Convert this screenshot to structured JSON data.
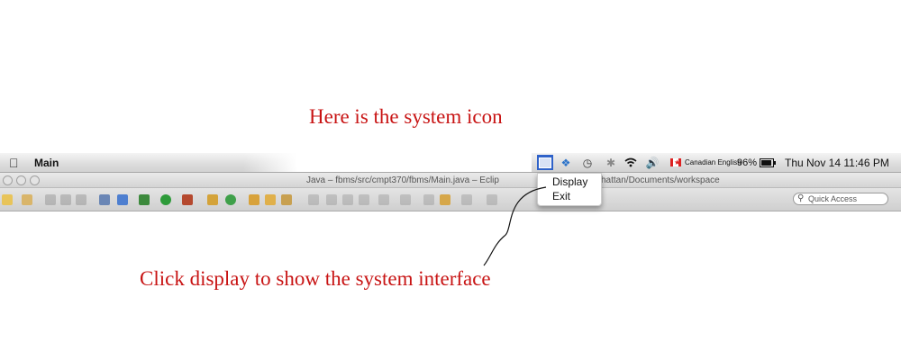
{
  "annotations": {
    "top": "Here is the system icon",
    "bottom": "Click display to show the system interface"
  },
  "menubar": {
    "app_name": "Main",
    "language": "Canadian English",
    "battery": "96%",
    "clock": "Thu Nov 14  11:46 PM"
  },
  "window": {
    "title": "Java – fbms/src/cmpt370/fbms/Main.java – Eclip",
    "title_tail": "hattan/Documents/workspace"
  },
  "toolbar": {
    "quick_access_placeholder": "Quick Access"
  },
  "tray_menu": {
    "items": [
      {
        "label": "Display"
      },
      {
        "label": "Exit"
      }
    ]
  },
  "icons": {
    "system_tray": "system-tray-icon",
    "dropbox": "dropbox-icon",
    "time_machine": "time-machine-icon",
    "bluetooth": "bluetooth-icon",
    "wifi": "wifi-icon",
    "volume": "volume-icon",
    "battery": "battery-icon"
  },
  "colors": {
    "annotation": "#c81414",
    "tray_highlight": "#2f62c9"
  }
}
